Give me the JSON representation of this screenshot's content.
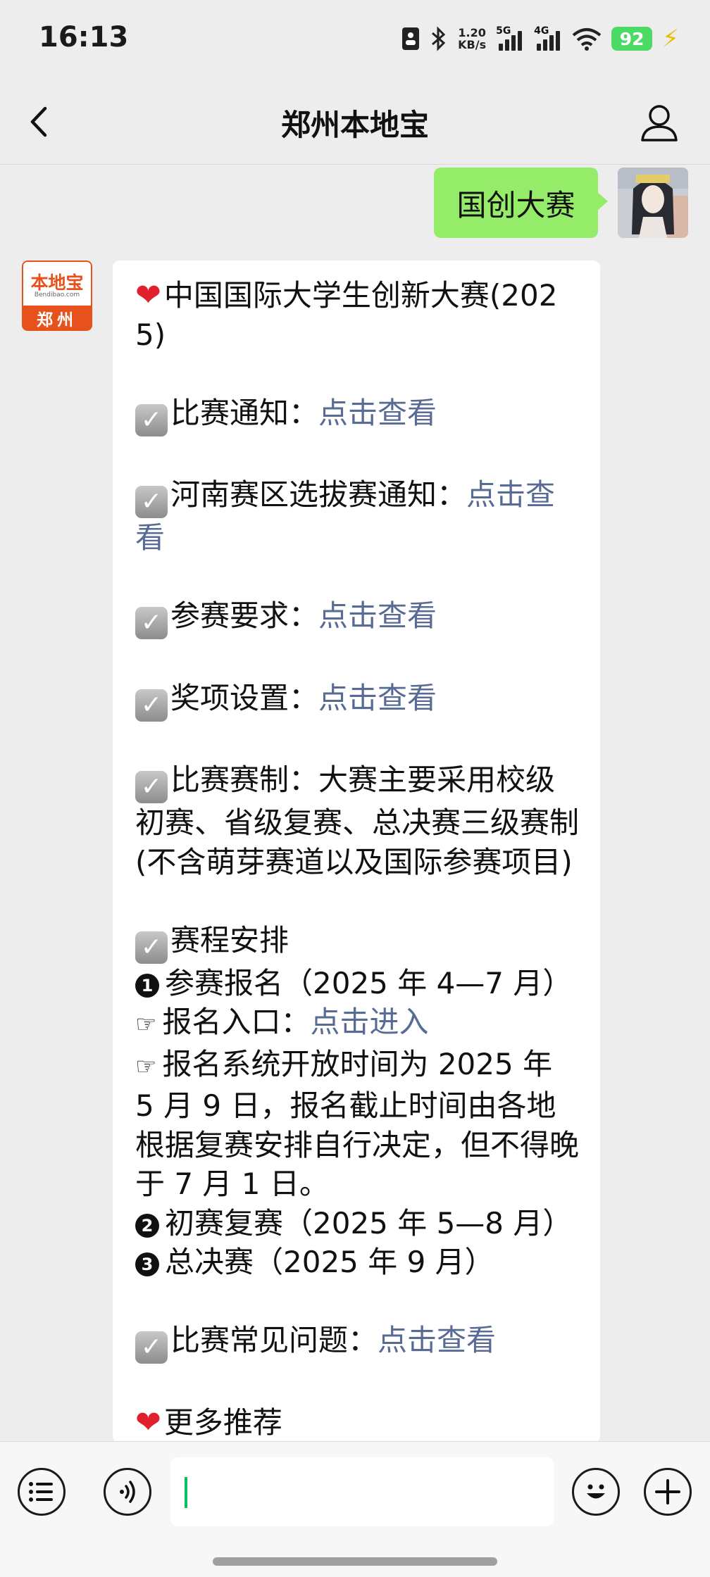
{
  "status_bar": {
    "time": "16:13",
    "net_speed": "1.20",
    "net_unit": "KB/s",
    "sim1": "5G",
    "sim2": "4G",
    "battery": "92"
  },
  "header": {
    "title": "郑州本地宝"
  },
  "user_message": "国创大赛",
  "bot_avatar": {
    "brand": "本地宝",
    "sub": "Bendibao.com",
    "city": "郑州"
  },
  "bot_message": {
    "title": "中国国际大学生创新大赛(2025)",
    "item1_label": "比赛通知：",
    "item1_link": "点击查看",
    "item2_label": "河南赛区选拔赛通知：",
    "item2_link": "点击查看",
    "item3_label": "参赛要求：",
    "item3_link": "点击查看",
    "item4_label": "奖项设置：",
    "item4_link": "点击查看",
    "item5_text": "比赛赛制：大赛主要采用校级初赛、省级复赛、总决赛三级赛制(不含萌芽赛道以及国际参赛项目)",
    "schedule_title": "赛程安排",
    "step1": "参赛报名（2025 年 4—7 月）",
    "step1_entry_label": "报名入口：",
    "step1_entry_link": "点击进入",
    "step1_note": "报名系统开放时间为 2025 年 5 月 9 日，报名截止时间由各地根据复赛安排自行决定，但不得晚于 7 月 1 日。",
    "step2": "初赛复赛（2025 年 5—8 月）",
    "step3": "总决赛（2025 年 9 月）",
    "faq_label": "比赛常见问题：",
    "faq_link": "点击查看",
    "more_title": "更多推荐"
  }
}
